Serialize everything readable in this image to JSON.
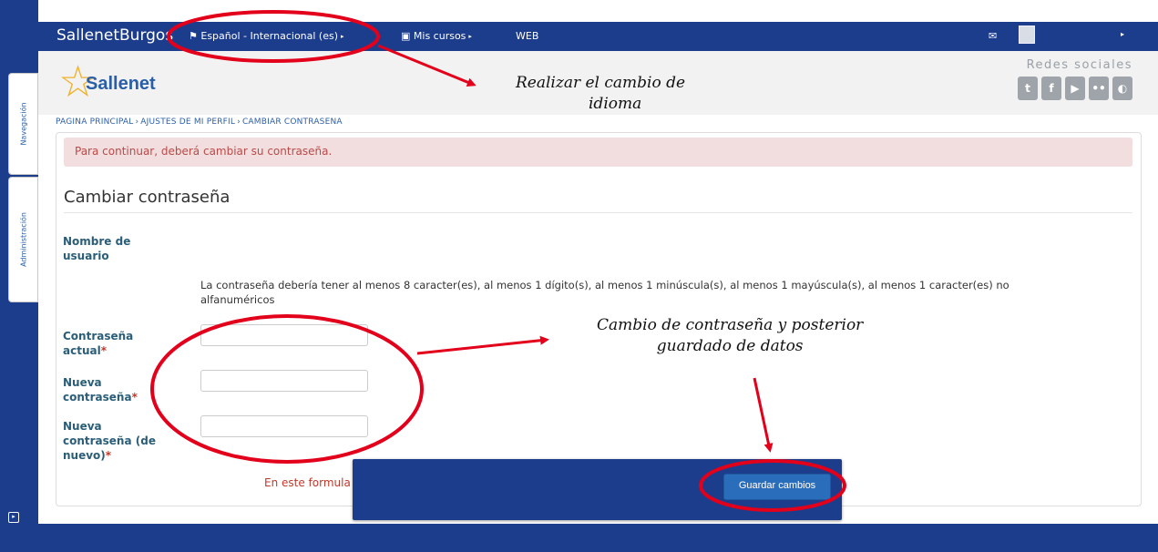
{
  "topbar": {
    "brand": "SallenetBurgos",
    "nav": [
      {
        "icon": "flag-icon",
        "label": "Español - Internacional (es)",
        "caret": "▸"
      },
      {
        "icon": "briefcase-icon",
        "label": "Mis cursos",
        "caret": "▸"
      },
      {
        "icon": "",
        "label": "WEB",
        "caret": ""
      }
    ],
    "user_caret": "▸"
  },
  "sidebar": {
    "tabs": [
      {
        "label": "Navegación"
      },
      {
        "label": "Administración"
      }
    ]
  },
  "header": {
    "logo_text": "Sallenet",
    "social_title": "Redes sociales",
    "social_icons": [
      "twitter-icon",
      "facebook-icon",
      "youtube-icon",
      "flickr-icon",
      "blog-icon"
    ]
  },
  "breadcrumb": [
    "PAGINA PRINCIPAL",
    "AJUSTES DE MI PERFIL",
    "CAMBIAR CONTRASENA"
  ],
  "breadcrumb_sep": "›",
  "alert": "Para continuar, deberá cambiar su contraseña.",
  "form": {
    "title": "Cambiar contraseña",
    "username_label_1": "Nombre de",
    "username_label_2": "usuario",
    "policy_1": "La contraseña debería tener al menos 8 caracter(es), al menos 1 dígito(s), al menos 1 minúscula(s), al menos 1 mayúscula(s), al menos 1 caracter(es) no",
    "policy_2": "alfanuméricos",
    "fields": [
      {
        "line1": "Contraseña",
        "line2": "actual",
        "line3": "",
        "value": ""
      },
      {
        "line1": "Nueva",
        "line2": "contraseña",
        "line3": "",
        "value": ""
      },
      {
        "line1": "Nueva",
        "line2": "contraseña (de",
        "line3": "nuevo)",
        "value": ""
      }
    ],
    "required_mark": "*",
    "required_note": "En este formula",
    "save_label": "Guardar cambios"
  },
  "annotations": {
    "language_note_1": "Realizar el cambio de",
    "language_note_2": "idioma",
    "password_note_1": "Cambio de contraseña y posterior",
    "password_note_2": "guardado de datos"
  },
  "colors": {
    "navy": "#1c3c8c",
    "link": "#2a5ea8",
    "alert_bg": "#f2dede",
    "annotation_red": "#e3001b"
  }
}
